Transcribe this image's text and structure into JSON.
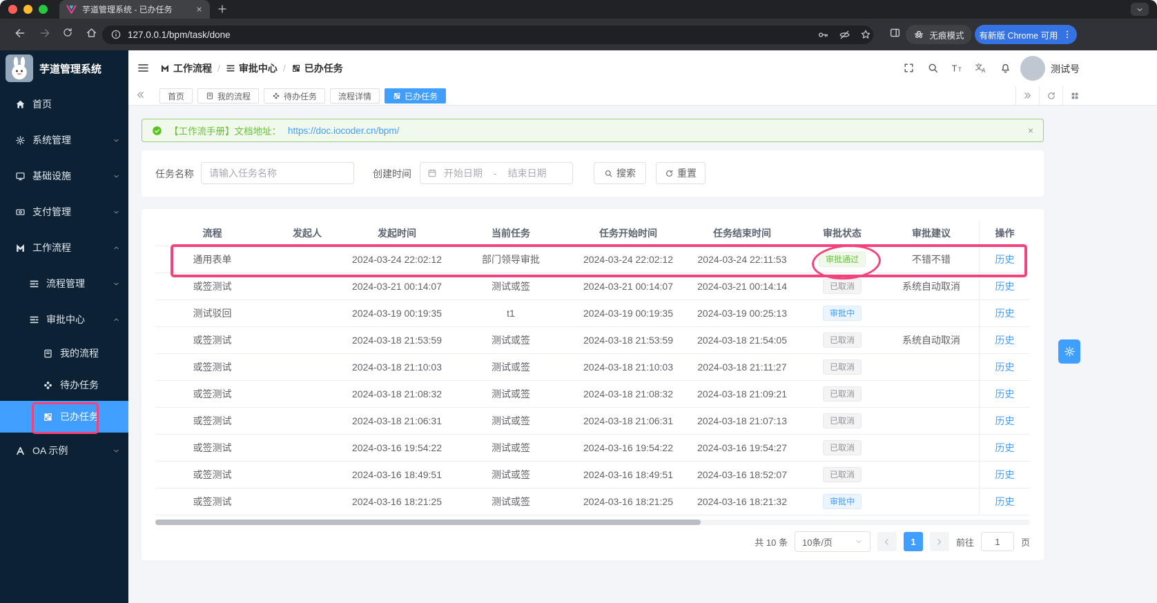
{
  "colors": {
    "accent": "#409eff",
    "success": "#67c23a",
    "info_gray": "#909399",
    "annotation_pink": "#f2437c",
    "sidebar_bg": "#0d2135",
    "banner_bg": "#f0f9eb",
    "chrome_update_blue": "#3572e3"
  },
  "browser": {
    "tab_title": "芋道管理系统 - 已办任务",
    "url": "127.0.0.1/bpm/task/done",
    "incognito_label": "无痕模式",
    "update_label": "有新版 Chrome 可用"
  },
  "header": {
    "logo_text": "芋道管理系统",
    "breadcrumb": [
      {
        "key": "workflow",
        "icon": "workflow-icon",
        "label": "工作流程"
      },
      {
        "key": "approval-center",
        "icon": "bars-icon",
        "label": "审批中心"
      },
      {
        "key": "done-tasks",
        "icon": "grid-icon",
        "label": "已办任务"
      }
    ],
    "username": "测试号",
    "icon_glyphs": {
      "font_size_big": "T",
      "font_size_small": "T",
      "translate_cjk": "文",
      "translate_latin": "A"
    }
  },
  "sidebar": {
    "items": [
      {
        "key": "home",
        "icon": "home-filled-icon",
        "label": "首页",
        "level": 0
      },
      {
        "key": "system-mgmt",
        "icon": "gear-icon",
        "label": "系统管理",
        "level": 0,
        "chevron": "down"
      },
      {
        "key": "infrastructure",
        "icon": "monitor-icon",
        "label": "基础设施",
        "level": 0,
        "chevron": "down"
      },
      {
        "key": "payment-mgmt",
        "icon": "payment-icon",
        "label": "支付管理",
        "level": 0,
        "chevron": "down"
      },
      {
        "key": "workflow",
        "icon": "workflow-icon",
        "label": "工作流程",
        "level": 0,
        "chevron": "up"
      },
      {
        "key": "process-mgmt",
        "icon": "bars-icon",
        "label": "流程管理",
        "level": 1,
        "chevron": "down"
      },
      {
        "key": "approval-center",
        "icon": "bars-icon",
        "label": "审批中心",
        "level": 1,
        "chevron": "up"
      },
      {
        "key": "my-process",
        "icon": "book-icon",
        "label": "我的流程",
        "level": 2
      },
      {
        "key": "todo-tasks",
        "icon": "puzzle-icon",
        "label": "待办任务",
        "level": 2
      },
      {
        "key": "done-tasks",
        "icon": "grid-icon",
        "label": "已办任务",
        "level": 2,
        "active": true
      },
      {
        "key": "oa-demo",
        "icon": "letter-a-icon",
        "label": "OA 示例",
        "level": 0,
        "chevron": "down"
      }
    ]
  },
  "tabs": {
    "items": [
      {
        "key": "home",
        "label": "首页"
      },
      {
        "key": "my-process",
        "label": "我的流程",
        "icon": "book-icon"
      },
      {
        "key": "todo-tasks",
        "label": "待办任务",
        "icon": "puzzle-icon"
      },
      {
        "key": "process-detail",
        "label": "流程详情"
      },
      {
        "key": "done-tasks",
        "label": "已办任务",
        "icon": "grid-icon",
        "active": true
      }
    ]
  },
  "banner": {
    "text": "【工作流手册】文档地址：",
    "link": "https://doc.iocoder.cn/bpm/",
    "close": "×"
  },
  "filter": {
    "name_label": "任务名称",
    "name_placeholder": "请输入任务名称",
    "time_label": "创建时间",
    "start_placeholder": "开始日期",
    "range_separator": "-",
    "end_placeholder": "结束日期",
    "search_label": "搜索",
    "reset_label": "重置"
  },
  "table": {
    "columns": [
      "流程",
      "发起人",
      "发起时间",
      "当前任务",
      "任务开始时间",
      "任务结束时间",
      "审批状态",
      "审批建议",
      "操作"
    ],
    "action_label": "历史",
    "rows": [
      {
        "process": "通用表单",
        "starter": "",
        "start_time": "2024-03-24 22:02:12",
        "task": "部门领导审批",
        "task_start": "2024-03-24 22:02:12",
        "task_end": "2024-03-24 22:11:53",
        "status": "审批通过",
        "status_type": "success",
        "suggest": "不错不错"
      },
      {
        "process": "或签测试",
        "starter": "",
        "start_time": "2024-03-21 00:14:07",
        "task": "测试或签",
        "task_start": "2024-03-21 00:14:07",
        "task_end": "2024-03-21 00:14:14",
        "status": "已取消",
        "status_type": "info",
        "suggest": "系统自动取消"
      },
      {
        "process": "测试驳回",
        "starter": "",
        "start_time": "2024-03-19 00:19:35",
        "task": "t1",
        "task_start": "2024-03-19 00:19:35",
        "task_end": "2024-03-19 00:25:13",
        "status": "审批中",
        "status_type": "primary",
        "suggest": ""
      },
      {
        "process": "或签测试",
        "starter": "",
        "start_time": "2024-03-18 21:53:59",
        "task": "测试或签",
        "task_start": "2024-03-18 21:53:59",
        "task_end": "2024-03-18 21:54:05",
        "status": "已取消",
        "status_type": "info",
        "suggest": "系统自动取消"
      },
      {
        "process": "或签测试",
        "starter": "",
        "start_time": "2024-03-18 21:10:03",
        "task": "测试或签",
        "task_start": "2024-03-18 21:10:03",
        "task_end": "2024-03-18 21:11:27",
        "status": "已取消",
        "status_type": "info",
        "suggest": ""
      },
      {
        "process": "或签测试",
        "starter": "",
        "start_time": "2024-03-18 21:08:32",
        "task": "测试或签",
        "task_start": "2024-03-18 21:08:32",
        "task_end": "2024-03-18 21:09:21",
        "status": "已取消",
        "status_type": "info",
        "suggest": ""
      },
      {
        "process": "或签测试",
        "starter": "",
        "start_time": "2024-03-18 21:06:31",
        "task": "测试或签",
        "task_start": "2024-03-18 21:06:31",
        "task_end": "2024-03-18 21:07:13",
        "status": "已取消",
        "status_type": "info",
        "suggest": ""
      },
      {
        "process": "或签测试",
        "starter": "",
        "start_time": "2024-03-16 19:54:22",
        "task": "测试或签",
        "task_start": "2024-03-16 19:54:22",
        "task_end": "2024-03-16 19:54:27",
        "status": "已取消",
        "status_type": "info",
        "suggest": ""
      },
      {
        "process": "或签测试",
        "starter": "",
        "start_time": "2024-03-16 18:49:51",
        "task": "测试或签",
        "task_start": "2024-03-16 18:49:51",
        "task_end": "2024-03-16 18:52:07",
        "status": "已取消",
        "status_type": "info",
        "suggest": ""
      },
      {
        "process": "或签测试",
        "starter": "",
        "start_time": "2024-03-16 18:21:25",
        "task": "测试或签",
        "task_start": "2024-03-16 18:21:25",
        "task_end": "2024-03-16 18:21:32",
        "status": "审批中",
        "status_type": "primary",
        "suggest": ""
      }
    ]
  },
  "pagination": {
    "total": "共 10 条",
    "page_size": "10条/页",
    "current_page": "1",
    "goto_label": "前往",
    "goto_value": "1",
    "page_unit": "页"
  }
}
